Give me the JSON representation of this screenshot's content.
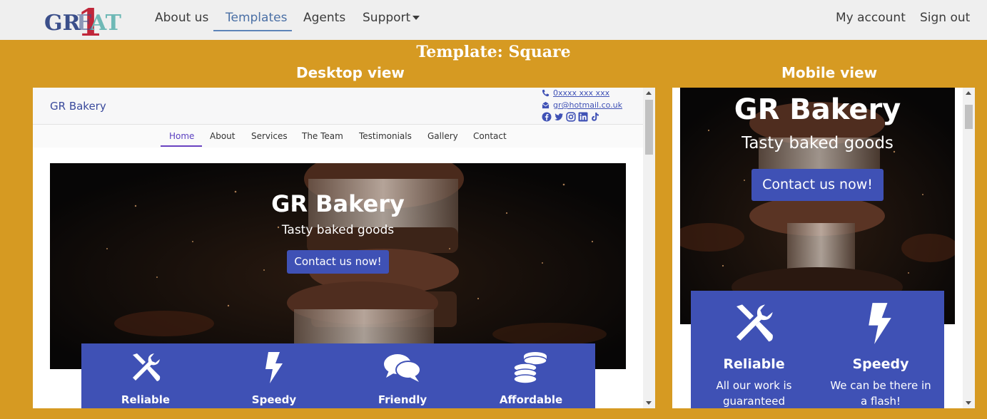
{
  "nav": {
    "logo_text": "GREAT",
    "logo_digit": "1",
    "links": [
      "About us",
      "Templates",
      "Agents",
      "Support"
    ],
    "right_links": [
      "My account",
      "Sign out"
    ],
    "active": "Templates"
  },
  "page": {
    "title": "Template: Square",
    "desktop_heading": "Desktop view",
    "mobile_heading": "Mobile view"
  },
  "desktop": {
    "brand": "GR Bakery",
    "phone": "0xxxx xxx xxx",
    "email": "gr@hotmail.co.uk",
    "socials": [
      "facebook-icon",
      "twitter-icon",
      "instagram-icon",
      "linkedin-icon",
      "tiktok-icon"
    ],
    "menu": [
      "Home",
      "About",
      "Services",
      "The Team",
      "Testimonials",
      "Gallery",
      "Contact"
    ],
    "hero_title": "GR Bakery",
    "hero_sub": "Tasty baked goods",
    "hero_btn": "Contact us now!",
    "features": [
      "Reliable",
      "Speedy",
      "Friendly",
      "Affordable"
    ]
  },
  "mobile": {
    "hero_title": "GR Bakery",
    "hero_sub": "Tasty baked goods",
    "hero_btn": "Contact us now!",
    "features": [
      {
        "label": "Reliable",
        "desc1": "All our work is",
        "desc2": "guaranteed"
      },
      {
        "label": "Speedy",
        "desc1": "We can be there in",
        "desc2": "a flash!"
      }
    ]
  },
  "colors": {
    "page_bg": "#d69a22",
    "accent": "#3f51b5"
  }
}
